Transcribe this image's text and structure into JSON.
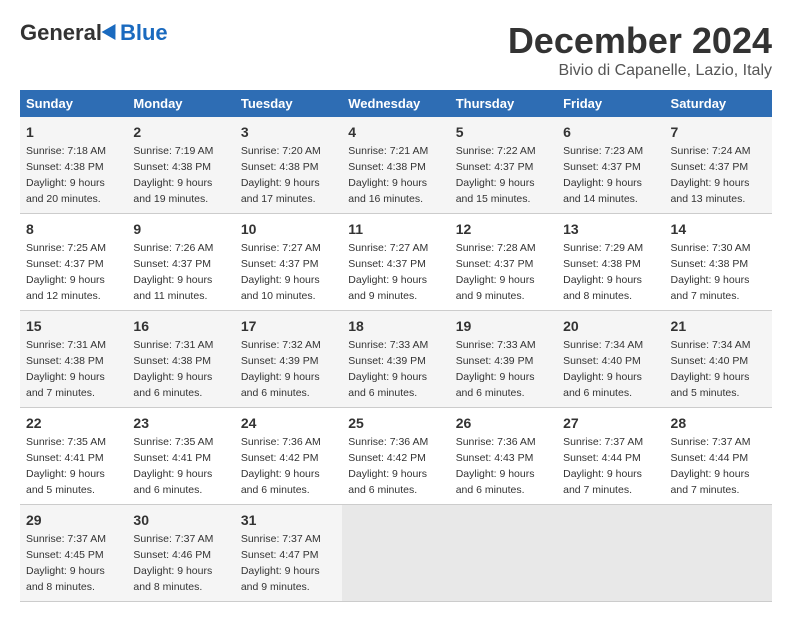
{
  "logo": {
    "general": "General",
    "blue": "Blue"
  },
  "title": {
    "month": "December 2024",
    "location": "Bivio di Capanelle, Lazio, Italy"
  },
  "days_header": [
    "Sunday",
    "Monday",
    "Tuesday",
    "Wednesday",
    "Thursday",
    "Friday",
    "Saturday"
  ],
  "weeks": [
    [
      {
        "day": "1",
        "sunrise": "7:18 AM",
        "sunset": "4:38 PM",
        "daylight": "9 hours and 20 minutes."
      },
      {
        "day": "2",
        "sunrise": "7:19 AM",
        "sunset": "4:38 PM",
        "daylight": "9 hours and 19 minutes."
      },
      {
        "day": "3",
        "sunrise": "7:20 AM",
        "sunset": "4:38 PM",
        "daylight": "9 hours and 17 minutes."
      },
      {
        "day": "4",
        "sunrise": "7:21 AM",
        "sunset": "4:38 PM",
        "daylight": "9 hours and 16 minutes."
      },
      {
        "day": "5",
        "sunrise": "7:22 AM",
        "sunset": "4:37 PM",
        "daylight": "9 hours and 15 minutes."
      },
      {
        "day": "6",
        "sunrise": "7:23 AM",
        "sunset": "4:37 PM",
        "daylight": "9 hours and 14 minutes."
      },
      {
        "day": "7",
        "sunrise": "7:24 AM",
        "sunset": "4:37 PM",
        "daylight": "9 hours and 13 minutes."
      }
    ],
    [
      {
        "day": "8",
        "sunrise": "7:25 AM",
        "sunset": "4:37 PM",
        "daylight": "9 hours and 12 minutes."
      },
      {
        "day": "9",
        "sunrise": "7:26 AM",
        "sunset": "4:37 PM",
        "daylight": "9 hours and 11 minutes."
      },
      {
        "day": "10",
        "sunrise": "7:27 AM",
        "sunset": "4:37 PM",
        "daylight": "9 hours and 10 minutes."
      },
      {
        "day": "11",
        "sunrise": "7:27 AM",
        "sunset": "4:37 PM",
        "daylight": "9 hours and 9 minutes."
      },
      {
        "day": "12",
        "sunrise": "7:28 AM",
        "sunset": "4:37 PM",
        "daylight": "9 hours and 9 minutes."
      },
      {
        "day": "13",
        "sunrise": "7:29 AM",
        "sunset": "4:38 PM",
        "daylight": "9 hours and 8 minutes."
      },
      {
        "day": "14",
        "sunrise": "7:30 AM",
        "sunset": "4:38 PM",
        "daylight": "9 hours and 7 minutes."
      }
    ],
    [
      {
        "day": "15",
        "sunrise": "7:31 AM",
        "sunset": "4:38 PM",
        "daylight": "9 hours and 7 minutes."
      },
      {
        "day": "16",
        "sunrise": "7:31 AM",
        "sunset": "4:38 PM",
        "daylight": "9 hours and 6 minutes."
      },
      {
        "day": "17",
        "sunrise": "7:32 AM",
        "sunset": "4:39 PM",
        "daylight": "9 hours and 6 minutes."
      },
      {
        "day": "18",
        "sunrise": "7:33 AM",
        "sunset": "4:39 PM",
        "daylight": "9 hours and 6 minutes."
      },
      {
        "day": "19",
        "sunrise": "7:33 AM",
        "sunset": "4:39 PM",
        "daylight": "9 hours and 6 minutes."
      },
      {
        "day": "20",
        "sunrise": "7:34 AM",
        "sunset": "4:40 PM",
        "daylight": "9 hours and 6 minutes."
      },
      {
        "day": "21",
        "sunrise": "7:34 AM",
        "sunset": "4:40 PM",
        "daylight": "9 hours and 5 minutes."
      }
    ],
    [
      {
        "day": "22",
        "sunrise": "7:35 AM",
        "sunset": "4:41 PM",
        "daylight": "9 hours and 5 minutes."
      },
      {
        "day": "23",
        "sunrise": "7:35 AM",
        "sunset": "4:41 PM",
        "daylight": "9 hours and 6 minutes."
      },
      {
        "day": "24",
        "sunrise": "7:36 AM",
        "sunset": "4:42 PM",
        "daylight": "9 hours and 6 minutes."
      },
      {
        "day": "25",
        "sunrise": "7:36 AM",
        "sunset": "4:42 PM",
        "daylight": "9 hours and 6 minutes."
      },
      {
        "day": "26",
        "sunrise": "7:36 AM",
        "sunset": "4:43 PM",
        "daylight": "9 hours and 6 minutes."
      },
      {
        "day": "27",
        "sunrise": "7:37 AM",
        "sunset": "4:44 PM",
        "daylight": "9 hours and 7 minutes."
      },
      {
        "day": "28",
        "sunrise": "7:37 AM",
        "sunset": "4:44 PM",
        "daylight": "9 hours and 7 minutes."
      }
    ],
    [
      {
        "day": "29",
        "sunrise": "7:37 AM",
        "sunset": "4:45 PM",
        "daylight": "9 hours and 8 minutes."
      },
      {
        "day": "30",
        "sunrise": "7:37 AM",
        "sunset": "4:46 PM",
        "daylight": "9 hours and 8 minutes."
      },
      {
        "day": "31",
        "sunrise": "7:37 AM",
        "sunset": "4:47 PM",
        "daylight": "9 hours and 9 minutes."
      },
      null,
      null,
      null,
      null
    ]
  ],
  "labels": {
    "sunrise": "Sunrise:",
    "sunset": "Sunset:",
    "daylight": "Daylight:"
  }
}
